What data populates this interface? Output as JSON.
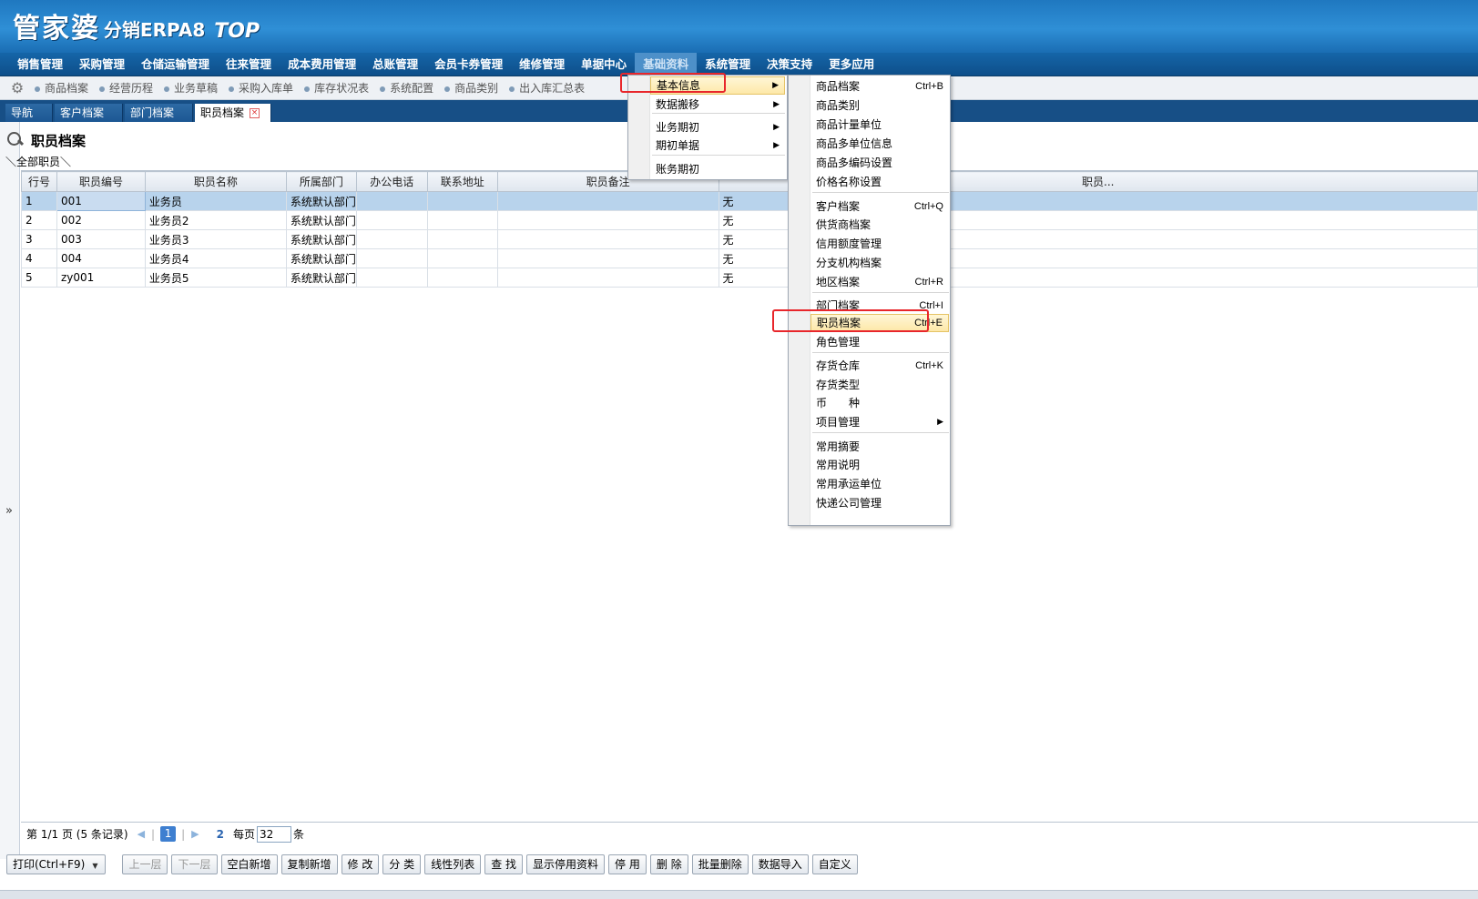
{
  "logo": {
    "brand": "管家婆",
    "product": "分销ERPA8",
    "edition": "TOP"
  },
  "menubar": [
    "销售管理",
    "采购管理",
    "仓储运输管理",
    "往来管理",
    "成本费用管理",
    "总账管理",
    "会员卡券管理",
    "维修管理",
    "单据中心",
    "基础资料",
    "系统管理",
    "决策支持",
    "更多应用"
  ],
  "active_menu": "基础资料",
  "quickbar": [
    "商品档案",
    "经营历程",
    "业务草稿",
    "采购入库单",
    "库存状况表",
    "系统配置",
    "商品类别",
    "出入库汇总表"
  ],
  "tabs": [
    {
      "label": "导航"
    },
    {
      "label": "客户档案"
    },
    {
      "label": "部门档案"
    },
    {
      "label": "职员档案",
      "closable": true,
      "close_icon": "×"
    }
  ],
  "page_title": "职员档案",
  "breadcrumb": "＼全部职员＼",
  "left_toggle": "»",
  "table": {
    "columns": [
      "行号",
      "职员编号",
      "职员名称",
      "所属部门",
      "办公电话",
      "联系地址",
      "职员备注",
      "职员..."
    ],
    "rows": [
      [
        "1",
        "001",
        "业务员",
        "系统默认部门",
        "",
        "",
        "",
        "无"
      ],
      [
        "2",
        "002",
        "业务员2",
        "系统默认部门",
        "",
        "",
        "",
        "无"
      ],
      [
        "3",
        "003",
        "业务员3",
        "系统默认部门",
        "",
        "",
        "",
        "无"
      ],
      [
        "4",
        "004",
        "业务员4",
        "系统默认部门",
        "",
        "",
        "",
        "无"
      ],
      [
        "5",
        "zy001",
        "业务员5",
        "系统默认部门",
        "",
        "",
        "",
        "无"
      ]
    ],
    "selected_row": 1
  },
  "pager": {
    "summary": "第  1/1 页 (5 条记录)",
    "prev_arrow": "◀",
    "next_arrow": "▶",
    "current_page": "1",
    "next_page": "2",
    "per_page_label": "每页",
    "per_page_value": "32",
    "unit": "条"
  },
  "toolbar": {
    "print": "打印(Ctrl+F9)",
    "buttons": [
      {
        "label": "上一层",
        "disabled": true
      },
      {
        "label": "下一层",
        "disabled": true
      },
      {
        "label": "空白新增"
      },
      {
        "label": "复制新增"
      },
      {
        "label": "修 改"
      },
      {
        "label": "分 类"
      },
      {
        "label": "线性列表"
      },
      {
        "label": "查 找"
      },
      {
        "label": "显示停用资料"
      },
      {
        "label": "停 用"
      },
      {
        "label": "删 除"
      },
      {
        "label": "批量删除"
      },
      {
        "label": "数据导入"
      },
      {
        "label": "自定义"
      }
    ]
  },
  "menu1": [
    {
      "label": "基本信息",
      "submenu": true,
      "highlighted": true
    },
    {
      "label": "数据搬移",
      "submenu": true
    },
    {
      "label": "业务期初",
      "submenu": true
    },
    {
      "label": "期初单据",
      "submenu": true
    },
    {
      "label": "账务期初",
      "submenu": false
    }
  ],
  "menu2": [
    {
      "label": "商品档案",
      "shortcut": "Ctrl+B"
    },
    {
      "label": "商品类别"
    },
    {
      "label": "商品计量单位"
    },
    {
      "label": "商品多单位信息"
    },
    {
      "label": "商品多编码设置"
    },
    {
      "label": "价格名称设置"
    },
    {
      "label": "客户档案",
      "shortcut": "Ctrl+Q"
    },
    {
      "label": "供货商档案"
    },
    {
      "label": "信用额度管理"
    },
    {
      "label": "分支机构档案"
    },
    {
      "label": "地区档案",
      "shortcut": "Ctrl+R"
    },
    {
      "label": "部门档案",
      "shortcut": "Ctrl+I"
    },
    {
      "label": "职员档案",
      "shortcut": "Ctrl+E",
      "highlighted": true
    },
    {
      "label": "角色管理"
    },
    {
      "label": "存货仓库",
      "shortcut": "Ctrl+K"
    },
    {
      "label": "存货类型"
    },
    {
      "label": "币　　种"
    },
    {
      "label": "项目管理",
      "submenu": true
    },
    {
      "label": "常用摘要"
    },
    {
      "label": "常用说明"
    },
    {
      "label": "常用承运单位"
    },
    {
      "label": "快递公司管理"
    }
  ],
  "colors": {
    "header": "#2f8fd6",
    "menubar": "#0e4f8a",
    "highlight_box": "#e8262b",
    "selected_row": "#b8d3ec"
  }
}
